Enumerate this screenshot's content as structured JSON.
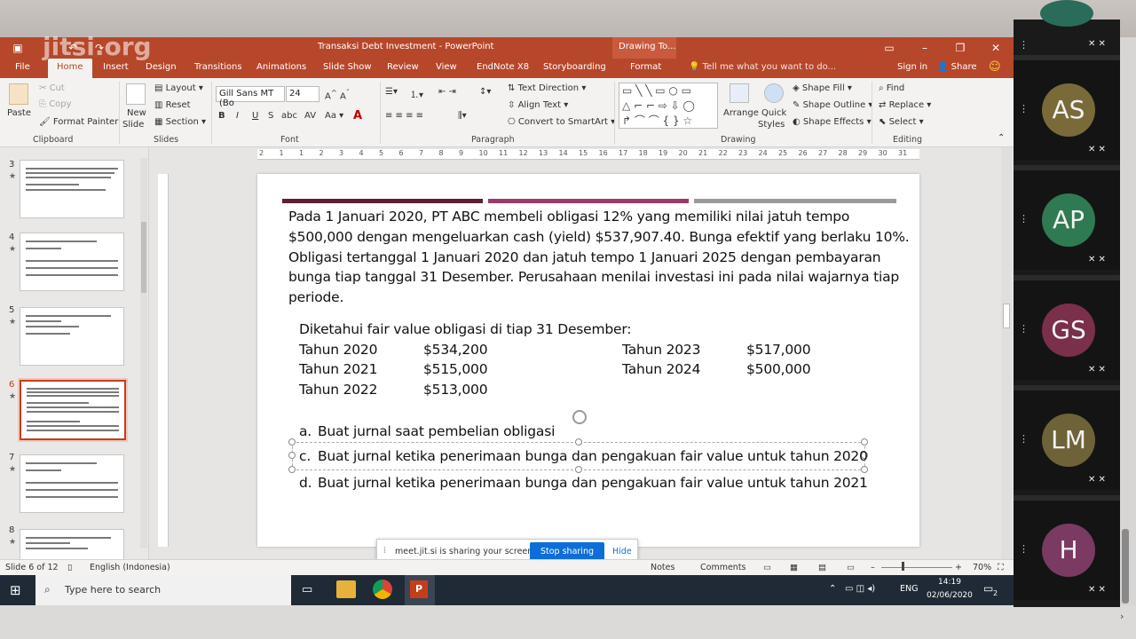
{
  "window": {
    "title": "Transaksi Debt Investment - PowerPoint",
    "context_tab": "Drawing To...",
    "watermark": "jitsi.org"
  },
  "tabs": [
    "File",
    "Home",
    "Insert",
    "Design",
    "Transitions",
    "Animations",
    "Slide Show",
    "Review",
    "View",
    "EndNote X8",
    "Storyboarding",
    "Format"
  ],
  "tell_me": "Tell me what you want to do...",
  "signin": "Sign in",
  "share": "Share",
  "ribbon": {
    "clipboard": {
      "paste": "Paste",
      "cut": "Cut",
      "copy": "Copy",
      "format_painter": "Format Painter",
      "label": "Clipboard"
    },
    "slides": {
      "new_slide": "New",
      "new_slide2": "Slide",
      "layout": "Layout",
      "reset": "Reset",
      "section": "Section",
      "label": "Slides"
    },
    "font": {
      "name": "Gill Sans MT (Bo",
      "size": "24",
      "label": "Font"
    },
    "paragraph": {
      "text_direction": "Text Direction",
      "align_text": "Align Text",
      "smartart": "Convert to SmartArt",
      "label": "Paragraph"
    },
    "drawing": {
      "arrange": "Arrange",
      "quick_styles": "Quick",
      "quick_styles2": "Styles",
      "shape_fill": "Shape Fill",
      "shape_outline": "Shape Outline",
      "shape_effects": "Shape Effects",
      "label": "Drawing"
    },
    "editing": {
      "find": "Find",
      "replace": "Replace",
      "select": "Select",
      "label": "Editing"
    }
  },
  "thumbnails": [
    {
      "num": "3",
      "star": "★"
    },
    {
      "num": "4",
      "star": "★"
    },
    {
      "num": "5",
      "star": "★"
    },
    {
      "num": "6",
      "star": "★"
    },
    {
      "num": "7",
      "star": "★"
    },
    {
      "num": "8",
      "star": "★"
    }
  ],
  "ruler_numbers": [
    "2",
    "1",
    "1",
    "2",
    "3",
    "4",
    "5",
    "6",
    "7",
    "8",
    "9",
    "10",
    "11",
    "12",
    "13",
    "14",
    "15",
    "16",
    "17",
    "18",
    "19",
    "20",
    "21",
    "22",
    "23",
    "24",
    "25",
    "26",
    "27",
    "28",
    "29",
    "30",
    "31"
  ],
  "slide": {
    "para_lines": [
      "Pada 1 Januari 2020, PT ABC membeli obligasi 12% yang memiliki nilai jatuh tempo",
      "$500,000 dengan mengeluarkan cash (yield) $537,907.40. Bunga efektif yang berlaku 10%.",
      "Obligasi tertanggal 1 Januari 2020 dan jatuh tempo 1 Januari 2025 dengan pembayaran",
      "bunga tiap tanggal 31 Desember. Perusahaan menilai investasi ini pada nilai wajarnya tiap",
      "periode."
    ],
    "fair_value_heading": "Diketahui fair value obligasi di tiap 31 Desember:",
    "fair_values": [
      {
        "year": "Tahun 2020",
        "value": "$534,200"
      },
      {
        "year": "Tahun 2021",
        "value": "$515,000"
      },
      {
        "year": "Tahun 2022",
        "value": "$513,000"
      },
      {
        "year": "Tahun 2023",
        "value": "$517,000"
      },
      {
        "year": "Tahun 2024",
        "value": "$500,000"
      }
    ],
    "tasks": [
      {
        "letter": "a.",
        "text": "Buat jurnal saat pembelian obligasi"
      },
      {
        "letter": "c.",
        "text": "Buat jurnal ketika penerimaan bunga dan pengakuan fair value untuk tahun 2020"
      },
      {
        "letter": "d.",
        "text": "Buat jurnal ketika penerimaan bunga dan pengakuan fair value untuk tahun 2021"
      }
    ]
  },
  "sharing": {
    "message": "meet.jit.si is sharing your screen.",
    "stop": "Stop sharing",
    "hide": "Hide"
  },
  "status": {
    "slide": "Slide 6 of 12",
    "language": "English (Indonesia)",
    "notes": "Notes",
    "comments": "Comments",
    "zoom": "70%"
  },
  "taskbar": {
    "search": "Type here to search",
    "lang": "ENG",
    "time": "14:19",
    "date": "02/06/2020",
    "notif": "2"
  },
  "participants": [
    {
      "initials": "AS",
      "color": "#7a6a3a"
    },
    {
      "initials": "AP",
      "color": "#2f7a52"
    },
    {
      "initials": "GS",
      "color": "#7a2f4a"
    },
    {
      "initials": "LM",
      "color": "#6e6238"
    },
    {
      "initials": "H",
      "color": "#7a3a62"
    }
  ],
  "colors": {
    "accent": "#b7472a",
    "bar1": "#5c2034",
    "bar2": "#9b3b6b",
    "bar3": "#9a9a9a",
    "stop_button": "#0e6ed8"
  }
}
